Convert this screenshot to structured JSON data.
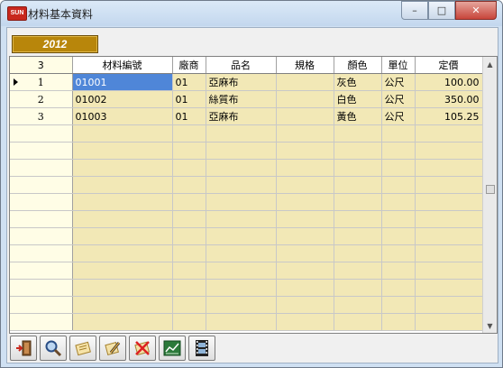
{
  "window": {
    "title": "材料基本資料",
    "app_icon_text": "SUN",
    "controls": {
      "minimize": "–",
      "maximize": "□",
      "close": "✕"
    }
  },
  "year_badge": "2012",
  "grid": {
    "record_count": "3",
    "columns": [
      "材料編號",
      "廠商",
      "品名",
      "規格",
      "顏色",
      "單位",
      "定價"
    ],
    "rows": [
      {
        "num": "1",
        "cells": [
          "01001",
          "01",
          "亞麻布",
          "",
          "灰色",
          "公尺",
          "100.00"
        ],
        "current": true
      },
      {
        "num": "2",
        "cells": [
          "01002",
          "01",
          "絲質布",
          "",
          "白色",
          "公尺",
          "350.00"
        ]
      },
      {
        "num": "3",
        "cells": [
          "01003",
          "01",
          "亞麻布",
          "",
          "黃色",
          "公尺",
          "105.25"
        ]
      }
    ],
    "empty_rows": 12
  },
  "toolbar": {
    "buttons": [
      {
        "name": "exit-button",
        "icon": "exit-door-icon"
      },
      {
        "name": "search-button",
        "icon": "magnifier-icon"
      },
      {
        "name": "add-button",
        "icon": "new-record-icon"
      },
      {
        "name": "edit-button",
        "icon": "edit-pencil-icon"
      },
      {
        "name": "delete-button",
        "icon": "delete-x-icon"
      },
      {
        "name": "chart-button",
        "icon": "chart-icon"
      },
      {
        "name": "film-button",
        "icon": "film-icon"
      }
    ]
  },
  "colors": {
    "accent_gold": "#b8860b",
    "cell_fill": "#f2e8b6",
    "selection": "#4f86d8"
  }
}
